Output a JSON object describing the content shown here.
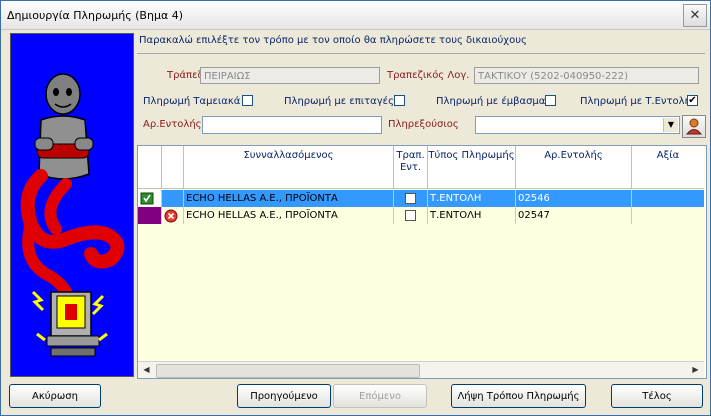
{
  "window": {
    "title": "Δημιουργία Πληρωμής (Βημα 4)",
    "close": "✕"
  },
  "instruction": "Παρακαλώ επιλέξτε τον τρόπο με τον οποίο θα πληρώσετε τους δικαιούχους",
  "form": {
    "bank_label": "Τράπεζα",
    "bank_value": "ΠΕΙΡΑΙΩΣ",
    "account_label": "Τραπεζικός Λογ.",
    "account_value": "ΤΑΚΤΙΚΟΥ (5202-040950-222)",
    "cash_label": "Πληρωμή Ταμειακά",
    "cash_checked": "",
    "cheque_label": "Πληρωμή με επιταγές",
    "cheque_checked": "",
    "transfer_label": "Πληρωμή με έμβασμα",
    "transfer_checked": "",
    "order_label": "Πληρωμή με Τ.Εντολή",
    "order_checked": "✔",
    "order_no_label": "Αρ.Εντολής:",
    "order_no_value": "",
    "payer_label": "Πληρεξούσιος",
    "payer_value": ""
  },
  "grid": {
    "headers": {
      "transactor": "Συνναλλασόμενος",
      "bank_order": "Τραπ. Εντ.",
      "payment_type": "Τύπος Πληρωμής",
      "order_no": "Αρ.Εντολής",
      "value": "Αξία"
    },
    "rows": [
      {
        "name": "ECHO HELLAS A.E., ΠΡΟΪΟΝΤΑ",
        "payment_type": "Τ.ΕΝΤΟΛΗ",
        "order_no": "02546",
        "value": ""
      },
      {
        "name": "ECHO HELLAS A.E., ΠΡΟΪΟΝΤΑ",
        "payment_type": "Τ.ΕΝΤΟΛΗ",
        "order_no": "02547",
        "value": ""
      }
    ]
  },
  "buttons": {
    "cancel": "Ακύρωση",
    "previous": "Προηγούμενο",
    "next": "Επόμενο",
    "get_payment": "Λήψη Τρόπου Πληρωμής",
    "finish": "Τέλος"
  },
  "colors": {
    "selected_row": "#3399ff",
    "row_bg": "#ffffe1",
    "left_panel": "#0000ff",
    "row_marker": "#800080"
  }
}
